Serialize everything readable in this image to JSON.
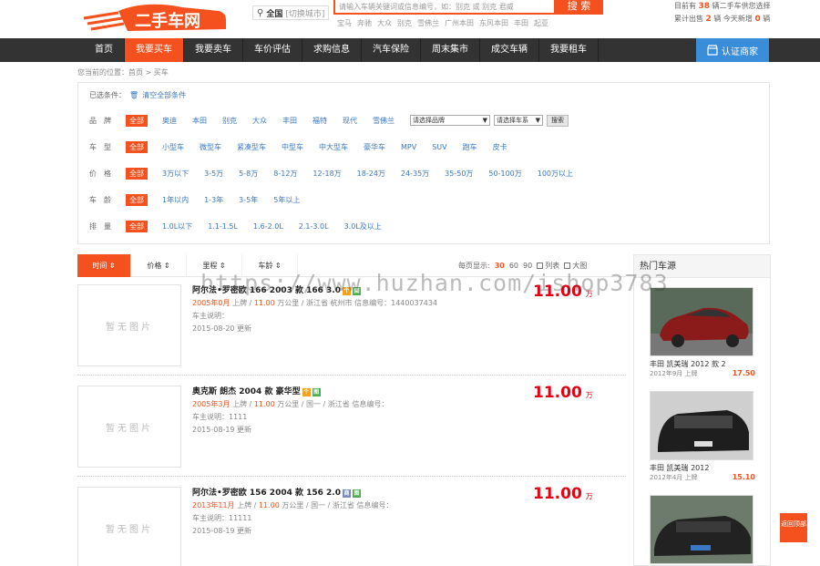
{
  "header": {
    "logo_text": "二手车网",
    "city": "全国",
    "city_switch": "[切换城市]",
    "search_placeholder": "请输入车辆关键词或信息编号，如：别克 或 别克 君威",
    "search_button": "搜 索",
    "hot_brands": [
      "宝马",
      "奔驰",
      "大众",
      "别克",
      "雪佛兰",
      "广州本田",
      "东风本田",
      "丰田",
      "起亚"
    ],
    "stats_line1_pre": "目前有",
    "stats_line1_num": "38",
    "stats_line1_post": "辆二手车供您选择",
    "stats_line2_pre": "累计出售",
    "stats_line2_num": "2",
    "stats_line2_mid": "辆 今天新增",
    "stats_line2_num2": "0",
    "stats_line2_post": "辆"
  },
  "nav": {
    "items": [
      "首页",
      "我要买车",
      "我要卖车",
      "车价评估",
      "求购信息",
      "汽车保险",
      "周末集市",
      "成交车辆",
      "我要租车"
    ],
    "active_index": 1,
    "cert_button": "认证商家"
  },
  "breadcrumb": "您当前的位置：首页 > 买车",
  "filter": {
    "chosen_label": "已选条件：",
    "clear_label": "清空全部条件",
    "all_label": "全部",
    "rows": [
      {
        "label": "品牌",
        "options": [
          "奥迪",
          "本田",
          "别克",
          "大众",
          "丰田",
          "福特",
          "现代",
          "雪佛兰"
        ]
      },
      {
        "label": "车型",
        "options": [
          "小型车",
          "微型车",
          "紧凑型车",
          "中型车",
          "中大型车",
          "豪华车",
          "MPV",
          "SUV",
          "跑车",
          "皮卡"
        ]
      },
      {
        "label": "价格",
        "options": [
          "3万以下",
          "3-5万",
          "5-8万",
          "8-12万",
          "12-18万",
          "18-24万",
          "24-35万",
          "35-50万",
          "50-100万",
          "100万以上"
        ]
      },
      {
        "label": "车龄",
        "options": [
          "1年以内",
          "1-3年",
          "3-5年",
          "5年以上"
        ]
      },
      {
        "label": "排量",
        "options": [
          "1.0L以下",
          "1.1-1.5L",
          "1.6-2.0L",
          "2.1-3.0L",
          "3.0L及以上"
        ]
      }
    ],
    "brand_select": "请选择品牌",
    "series_select": "请选择车系",
    "search_button": "搜索"
  },
  "sortbar": {
    "sorts": [
      "时间",
      "价格",
      "里程",
      "车龄"
    ],
    "per_page_label": "每页显示:",
    "per_page": [
      "30",
      "60",
      "90"
    ],
    "list_view": "列表",
    "grid_view": "大图"
  },
  "listings": [
    {
      "title": "阿尔法•罗密欧 166 2003 款 166 3.0",
      "date": "2005年0月",
      "mileage": "11.00",
      "location": "浙江省 杭州市",
      "info_no": "信息编号：1440037434",
      "desc": "车主说明：",
      "updated": "2015-08-20 更新",
      "price": "11.00",
      "placeholder": "暂无图片",
      "tags": [
        "#f4a21b",
        "#4caf50"
      ]
    },
    {
      "title": "奥克斯 朗杰 2004 款 豪华型",
      "date": "2005年3月",
      "mileage": "11.00",
      "location": "国一",
      "info_no": "浙江省 信息编号：",
      "desc": "车主说明：1111",
      "updated": "2015-08-19 更新",
      "price": "11.00",
      "placeholder": "暂无图片",
      "tags": [
        "#f4a21b",
        "#4caf50"
      ]
    },
    {
      "title": "阿尔法•罗密欧 156 2004 款 156 2.0",
      "date": "2013年11月",
      "mileage": "11.00",
      "location": "国一",
      "info_no": "浙江省 信息编号：",
      "desc": "车主说明：11111",
      "updated": "2015-08-19 更新",
      "price": "11.00",
      "placeholder": "暂无图片",
      "tags": [
        "#7a8bbf",
        "#4caf50"
      ]
    }
  ],
  "listing_labels": {
    "listed": "上牌",
    "mileage_unit": "万公里",
    "price_unit": "万"
  },
  "sidebar": {
    "title": "热门车源",
    "cars": [
      {
        "name": "丰田 凯美瑞 2012 款 2",
        "date": "2012年9月 上牌",
        "price": "17.50",
        "color": "#8b1a1a"
      },
      {
        "name": "丰田 凯美瑞 2012",
        "date": "2012年4月 上牌",
        "price": "15.10",
        "color": "#1e1e1e"
      },
      {
        "name": "",
        "date": "",
        "price": "",
        "color": "#222"
      }
    ]
  },
  "backtop": "返回顶部",
  "watermark": "https://www.huzhan.com/ishop3783"
}
